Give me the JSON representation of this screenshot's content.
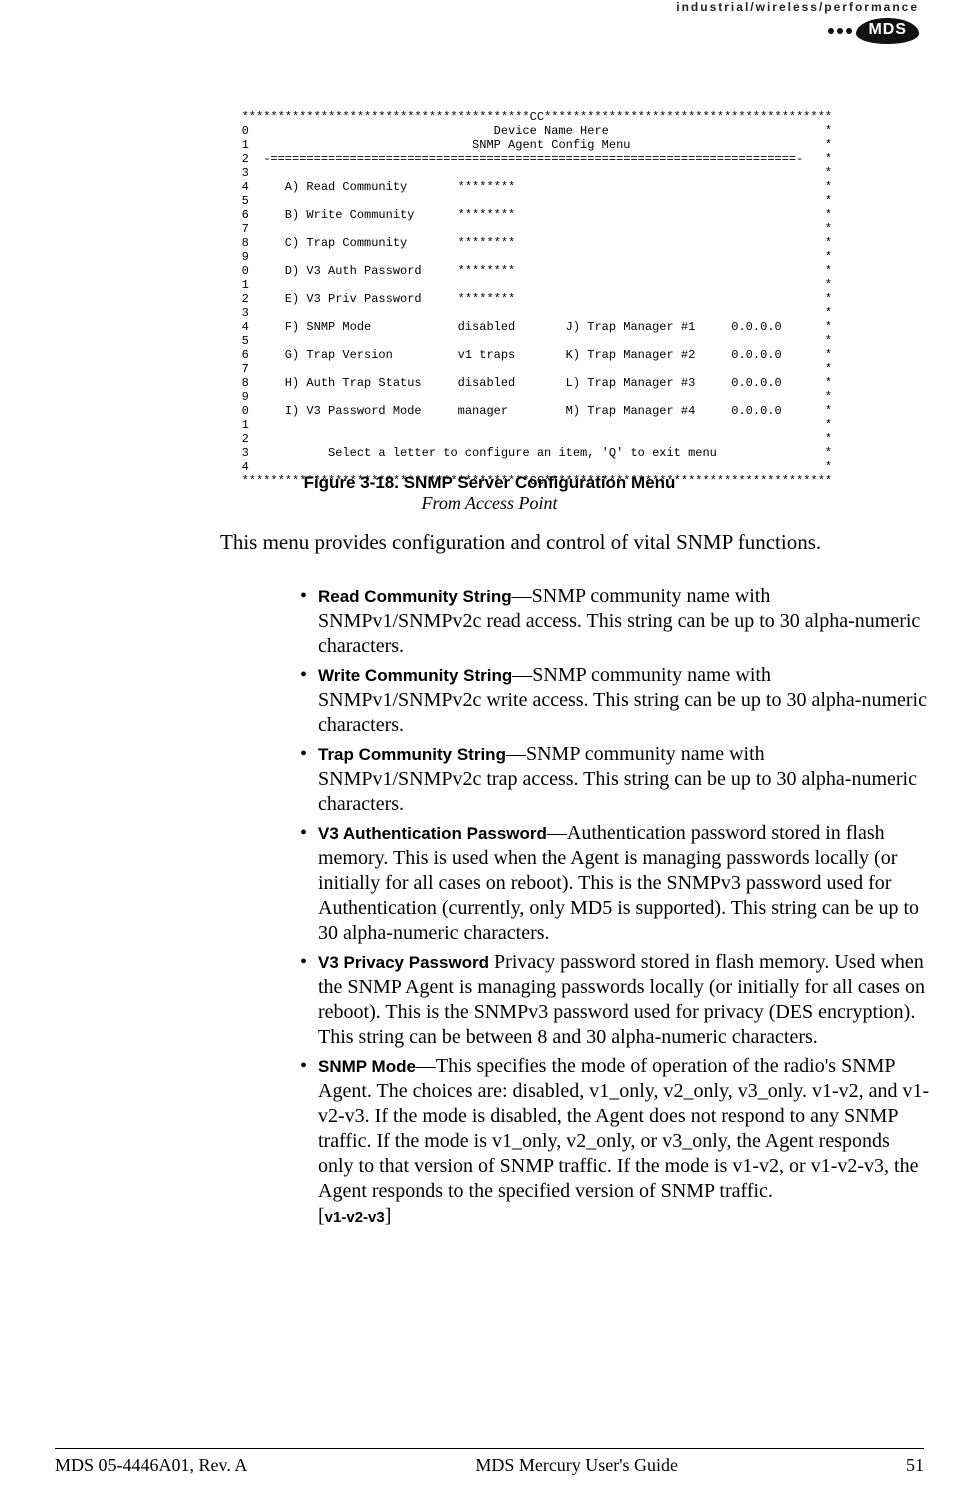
{
  "header": {
    "tagline": "industrial/wireless/performance",
    "logo_text": "MDS"
  },
  "terminal": {
    "lines": [
      "   ****************************************CC****************************************",
      "   0                                  Device Name Here                              *",
      "   1                               SNMP Agent Config Menu                           *",
      "   2  -=========================================================================-   *",
      "   3                                                                                *",
      "   4     A) Read Community       ********                                           *",
      "   5                                                                                *",
      "   6     B) Write Community      ********                                           *",
      "   7                                                                                *",
      "   8     C) Trap Community       ********                                           *",
      "   9                                                                                *",
      "   0     D) V3 Auth Password     ********                                           *",
      "   1                                                                                *",
      "   2     E) V3 Priv Password     ********                                           *",
      "   3                                                                                *",
      "   4     F) SNMP Mode            disabled       J) Trap Manager #1     0.0.0.0      *",
      "   5                                                                                *",
      "   6     G) Trap Version         v1 traps       K) Trap Manager #2     0.0.0.0      *",
      "   7                                                                                *",
      "   8     H) Auth Trap Status     disabled       L) Trap Manager #3     0.0.0.0      *",
      "   9                                                                                *",
      "   0     I) V3 Password Mode     manager        M) Trap Manager #4     0.0.0.0      *",
      "   1                                                                                *",
      "   2                                                                                *",
      "   3           Select a letter to configure an item, 'Q' to exit menu               *",
      "   4                                                                                *",
      "   ****************************************CC****************************************"
    ]
  },
  "caption": {
    "title": "Figure 3-18. SNMP Server Configuration Menu",
    "subtitle": "From Access Point"
  },
  "intro": "This menu provides configuration and control of vital SNMP functions.",
  "bullets": {
    "b1_label": "Read Community String",
    "b1_text": "—SNMP community name with SNMPv1/SNMPv2c read access. This string can be up to 30 alpha-numeric characters.",
    "b2_label": "Write Community String",
    "b2_text": "—SNMP community name with SNMPv1/SNMPv2c write access. This string can be up to 30 alpha-numeric characters.",
    "b3_label": "Trap Community String",
    "b3_text": "—SNMP community name with SNMPv1/SNMPv2c trap access. This string can be up to 30 alpha-numeric characters.",
    "b4_label": "V3 Authentication Password",
    "b4_text": "—Authentication password stored in flash memory. This is used when the Agent is managing passwords locally (or initially for all cases on reboot). This is the SNMPv3 password used for Authentication (currently, only MD5 is supported). This string can be up to 30 alpha-numeric characters.",
    "b5_label": "V3 Privacy Password",
    "b5_text": " Privacy password stored in flash memory. Used when the SNMP Agent is managing passwords locally (or initially for all cases on reboot). This is the SNMPv3 password used for privacy (DES encryption). This string can be between 8 and 30 alpha-numeric characters.",
    "b6_label": "SNMP Mode",
    "b6_text": "—This specifies the mode of operation of the radio's SNMP Agent. The choices are: disabled, v1_only, v2_only, v3_only. v1-v2, and v1-v2-v3. If the mode is disabled, the Agent does not respond to any SNMP traffic. If the mode is v1_only, v2_only, or v3_only, the Agent responds only to that version of SNMP traffic. If the mode is v1-v2, or v1-v2-v3, the Agent responds to the specified version of SNMP traffic.",
    "b6_bracket": "[",
    "b6_val": "v1-v2-v3",
    "b6_bracket_close": "]"
  },
  "footer": {
    "left": "MDS 05-4446A01, Rev. A",
    "center": "MDS Mercury User's Guide",
    "right": "51"
  }
}
